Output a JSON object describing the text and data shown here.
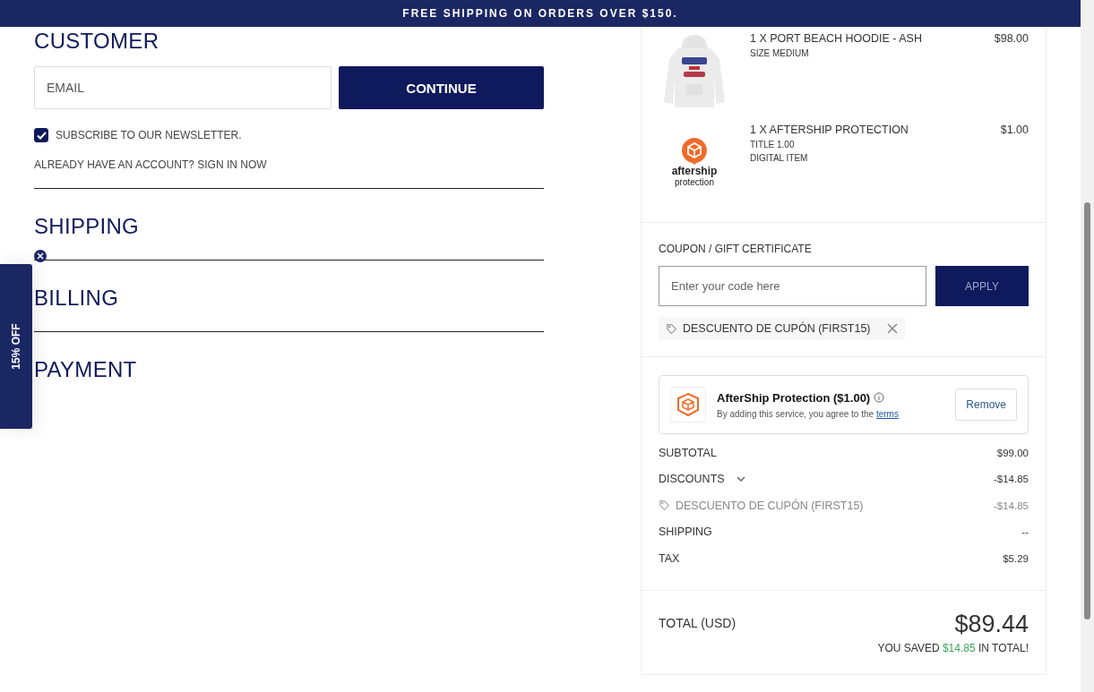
{
  "banner": "FREE SHIPPING ON ORDERS OVER $150.",
  "customer": {
    "heading": "CUSTOMER",
    "email": {
      "placeholder": "EMAIL"
    },
    "continue": "CONTINUE",
    "newsletter": {
      "label": "SUBSCRIBE TO OUR NEWSLETTER.",
      "checked": true
    },
    "sign_in": "ALREADY HAVE AN ACCOUNT? SIGN IN NOW"
  },
  "sections": [
    "SHIPPING",
    "BILLING",
    "PAYMENT"
  ],
  "promo_tab": {
    "label": "15% OFF"
  },
  "cart_items": [
    {
      "kind": "hoodie",
      "title": "1 X PORT BEACH HOODIE - ASH",
      "details": [
        "SIZE MEDIUM"
      ],
      "price": "$98.00"
    },
    {
      "kind": "protection",
      "title": "1 X AFTERSHIP PROTECTION",
      "details": [
        "TITLE 1.00",
        "DIGITAL ITEM"
      ],
      "price": "$1.00",
      "logo": {
        "name": "aftership",
        "sub": "protection"
      }
    }
  ],
  "coupon": {
    "label": "COUPON / GIFT CERTIFICATE",
    "placeholder": "Enter your code here",
    "apply": "APPLY",
    "applied": "DESCUENTO DE CUPÓN (FIRST15)"
  },
  "protection": {
    "title": "AfterShip Protection ($1.00)",
    "note": "By adding this service, you agree to the",
    "link": "terms",
    "button": "Remove"
  },
  "summary": [
    {
      "kind": "line",
      "label": "SUBTOTAL",
      "value": "$99.00"
    },
    {
      "kind": "expandable",
      "label": "DISCOUNTS",
      "value": "-$14.85",
      "expanded": true
    },
    {
      "kind": "sub",
      "label": "DESCUENTO DE CUPÓN (FIRST15)",
      "value": "-$14.85"
    },
    {
      "kind": "line",
      "label": "SHIPPING",
      "value": "--"
    },
    {
      "kind": "line",
      "label": "TAX",
      "value": "$5.29"
    }
  ],
  "total": {
    "label": "TOTAL (USD)",
    "amount": "$89.44",
    "saved_before": "YOU SAVED",
    "saved_amount": "$14.85",
    "saved_after": "IN TOTAL!"
  }
}
